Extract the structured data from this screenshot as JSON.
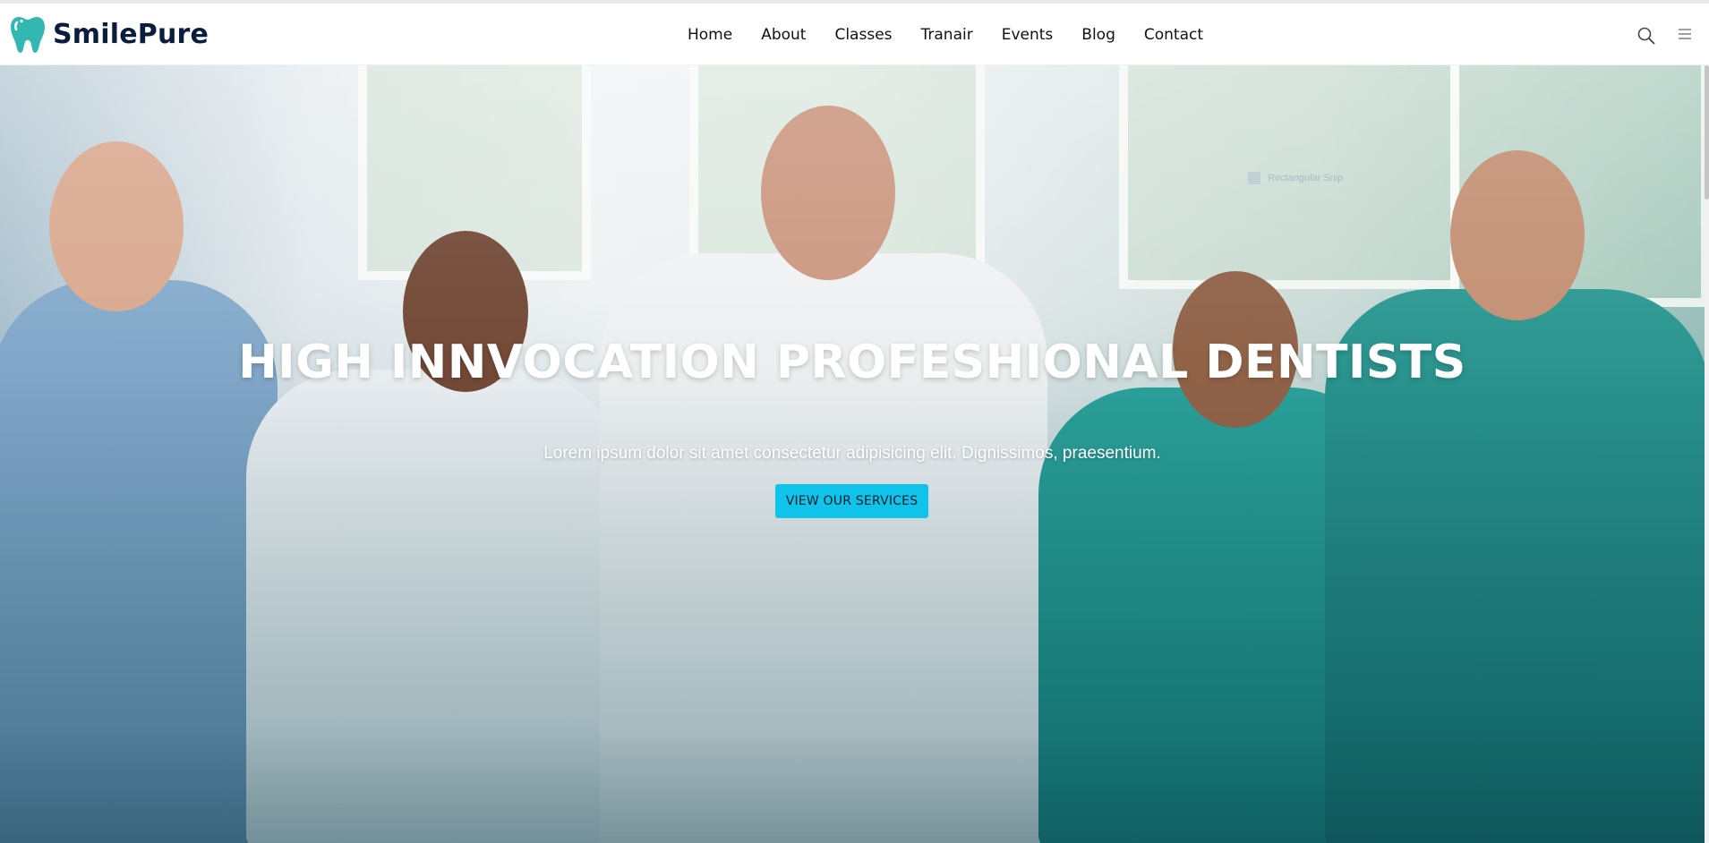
{
  "brand": {
    "name": "SmilePure",
    "logo_icon": "tooth-icon",
    "accent_color": "#34b7b3"
  },
  "nav": {
    "links": [
      "Home",
      "About",
      "Classes",
      "Tranair",
      "Events",
      "Blog",
      "Contact"
    ],
    "search_icon": "search-icon",
    "menu_icon": "hamburger-menu-icon"
  },
  "hero": {
    "title": "HIGH INNVOCATION PROFESHIONAL DENTISTS",
    "subtitle": "Lorem ipsum dolor sit amet consectetur adipisicing elit. Dignissimos, praesentium.",
    "cta_label": "VIEW OUR SERVICES",
    "cta_color": "#0fc3ea",
    "overlay_tag": "Rectangular Snip"
  }
}
